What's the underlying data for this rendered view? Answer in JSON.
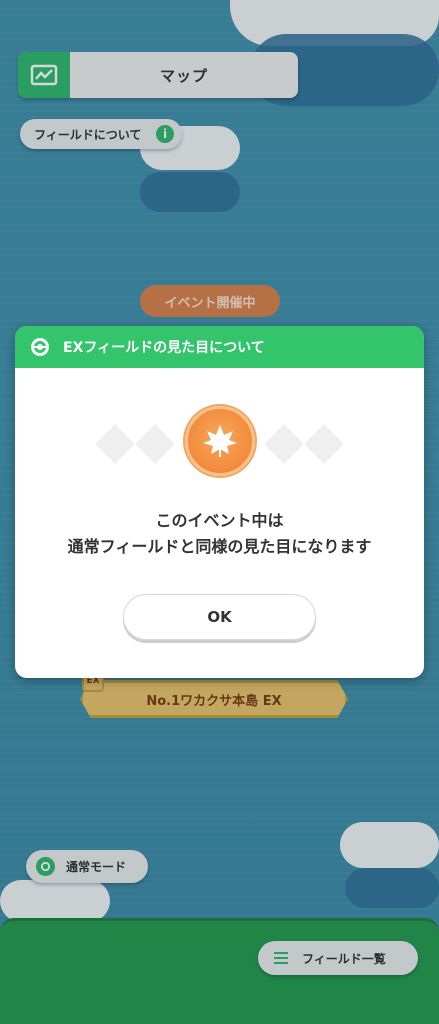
{
  "header": {
    "title": "マップ"
  },
  "field_about": {
    "label": "フィールドについて",
    "info_glyph": "i"
  },
  "event_badge": {
    "label": "イベント開催中"
  },
  "island": {
    "ex_tag": "EX",
    "name": "No.1ワカクサ本島 EX"
  },
  "mode_button": {
    "label": "通常モード"
  },
  "field_list_button": {
    "label": "フィールド一覧"
  },
  "dialog": {
    "title": "EXフィールドの見た目について",
    "message_line1": "このイベント中は",
    "message_line2": "通常フィールドと同様の見た目になります",
    "ok_label": "OK"
  },
  "colors": {
    "accent_green": "#34c46b",
    "sea": "#3f90a8",
    "medal": "#f28a3c",
    "event_badge": "#d9804a"
  },
  "icons": [
    "map-icon",
    "info-icon",
    "pokeball-icon",
    "leaf-medal-icon",
    "refresh-icon",
    "menu-icon"
  ]
}
